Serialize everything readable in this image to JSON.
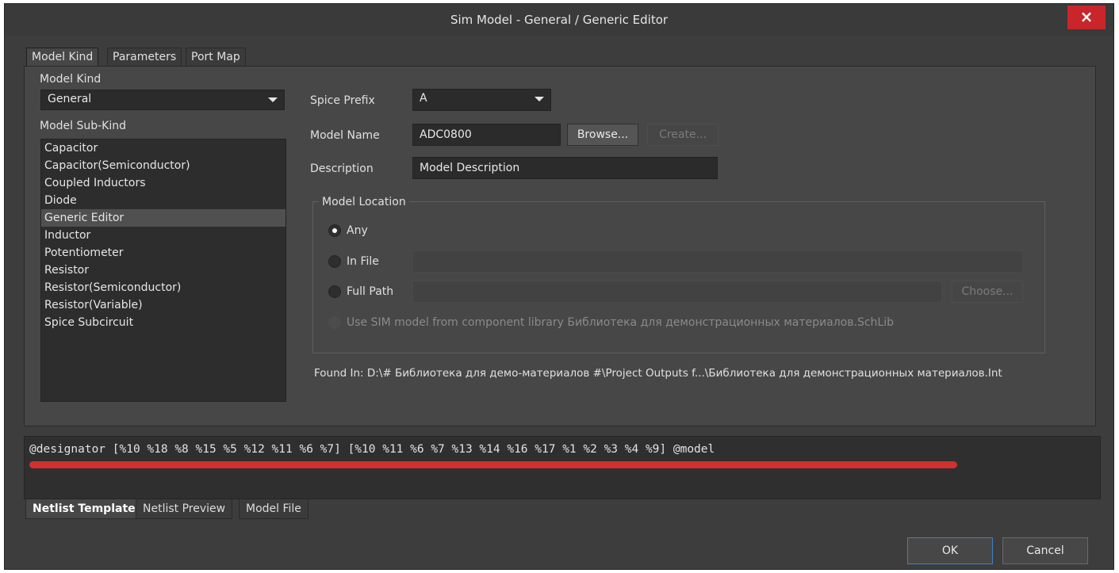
{
  "window": {
    "title": "Sim Model - General / Generic Editor",
    "close_label": "×"
  },
  "tabs": [
    "Model Kind",
    "Parameters",
    "Port Map"
  ],
  "model_kind": {
    "label": "Model Kind",
    "value": "General"
  },
  "sub_kind": {
    "label": "Model Sub-Kind",
    "items": [
      "Capacitor",
      "Capacitor(Semiconductor)",
      "Coupled Inductors",
      "Diode",
      "Generic Editor",
      "Inductor",
      "Potentiometer",
      "Resistor",
      "Resistor(Semiconductor)",
      "Resistor(Variable)",
      "Spice Subcircuit"
    ],
    "selected": "Generic Editor"
  },
  "spice_prefix": {
    "label": "Spice Prefix",
    "value": "A"
  },
  "model_name": {
    "label": "Model Name",
    "value": "ADC0800",
    "browse_label": "Browse...",
    "create_label": "Create..."
  },
  "description": {
    "label": "Description",
    "value": "Model Description"
  },
  "model_location": {
    "title": "Model Location",
    "any_label": "Any",
    "in_file_label": "In File",
    "full_path_label": "Full Path",
    "choose_label": "Choose...",
    "use_sim_label": "Use SIM model from component library Библиотека для демонстрационных материалов.SchLib",
    "selected": "Any"
  },
  "found_in": "Found In:  D:\\# Библиотека для демо-материалов #\\Project Outputs f...\\Библиотека для демонстрационных материалов.Int",
  "netlist_template": "@designator [%10 %18 %8 %15 %5 %12 %11 %6 %7] [%10 %11 %6 %7 %13 %14 %16 %17 %1 %2 %3 %4 %9] @model",
  "bottom_tabs": [
    "Netlist Template",
    "Netlist Preview",
    "Model File"
  ],
  "footer": {
    "ok_label": "OK",
    "cancel_label": "Cancel"
  },
  "colors": {
    "background": "#3d3d3d",
    "panel": "#474747",
    "close_button": "#c8262b",
    "annotation_underline": "#d0302e",
    "ok_border": "#3f7fc5"
  },
  "icons": {
    "close": "close-icon",
    "dropdown": "chevron-down-icon"
  }
}
